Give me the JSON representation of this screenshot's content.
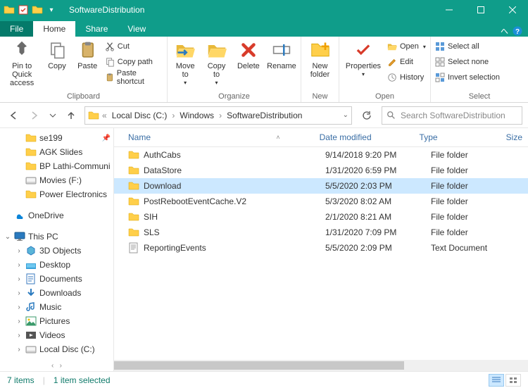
{
  "titlebar": {
    "title": "SoftwareDistribution"
  },
  "tabs": {
    "file": "File",
    "home": "Home",
    "share": "Share",
    "view": "View"
  },
  "ribbon": {
    "clipboard": {
      "label": "Clipboard",
      "pin": "Pin to Quick\naccess",
      "copy": "Copy",
      "paste": "Paste",
      "cut": "Cut",
      "copypath": "Copy path",
      "pasteshortcut": "Paste shortcut"
    },
    "organize": {
      "label": "Organize",
      "moveto": "Move\nto",
      "copyto": "Copy\nto",
      "delete": "Delete",
      "rename": "Rename"
    },
    "new": {
      "label": "New",
      "newfolder": "New\nfolder"
    },
    "open": {
      "label": "Open",
      "properties": "Properties",
      "open": "Open",
      "edit": "Edit",
      "history": "History"
    },
    "select": {
      "label": "Select",
      "selectall": "Select all",
      "selectnone": "Select none",
      "invert": "Invert selection"
    }
  },
  "breadcrumbs": [
    "Local Disc (C:)",
    "Windows",
    "SoftwareDistribution"
  ],
  "search": {
    "placeholder": "Search SoftwareDistribution"
  },
  "columns": {
    "name": "Name",
    "date": "Date modified",
    "type": "Type",
    "size": "Size"
  },
  "navtree": {
    "quick": [
      {
        "label": "se199",
        "icon": "folder",
        "pinned": true
      },
      {
        "label": "AGK Slides",
        "icon": "folder"
      },
      {
        "label": "BP Lathi-Communi",
        "icon": "folder"
      },
      {
        "label": "Movies (F:)",
        "icon": "drive"
      },
      {
        "label": "Power Electronics",
        "icon": "folder"
      }
    ],
    "onedrive": "OneDrive",
    "thispc": "This PC",
    "thispc_children": [
      {
        "label": "3D Objects",
        "icon": "3d"
      },
      {
        "label": "Desktop",
        "icon": "desktop"
      },
      {
        "label": "Documents",
        "icon": "documents"
      },
      {
        "label": "Downloads",
        "icon": "downloads"
      },
      {
        "label": "Music",
        "icon": "music"
      },
      {
        "label": "Pictures",
        "icon": "pictures"
      },
      {
        "label": "Videos",
        "icon": "videos"
      },
      {
        "label": "Local Disc (C:)",
        "icon": "drive"
      }
    ]
  },
  "files": [
    {
      "name": "AuthCabs",
      "date": "9/14/2018 9:20 PM",
      "type": "File folder",
      "icon": "folder",
      "selected": false
    },
    {
      "name": "DataStore",
      "date": "1/31/2020 6:59 PM",
      "type": "File folder",
      "icon": "folder",
      "selected": false
    },
    {
      "name": "Download",
      "date": "5/5/2020 2:03 PM",
      "type": "File folder",
      "icon": "folder",
      "selected": true
    },
    {
      "name": "PostRebootEventCache.V2",
      "date": "5/3/2020 8:02 AM",
      "type": "File folder",
      "icon": "folder",
      "selected": false
    },
    {
      "name": "SIH",
      "date": "2/1/2020 8:21 AM",
      "type": "File folder",
      "icon": "folder",
      "selected": false
    },
    {
      "name": "SLS",
      "date": "1/31/2020 7:09 PM",
      "type": "File folder",
      "icon": "folder",
      "selected": false
    },
    {
      "name": "ReportingEvents",
      "date": "5/5/2020 2:09 PM",
      "type": "Text Document",
      "icon": "text",
      "selected": false
    }
  ],
  "status": {
    "count": "7 items",
    "selection": "1 item selected"
  }
}
